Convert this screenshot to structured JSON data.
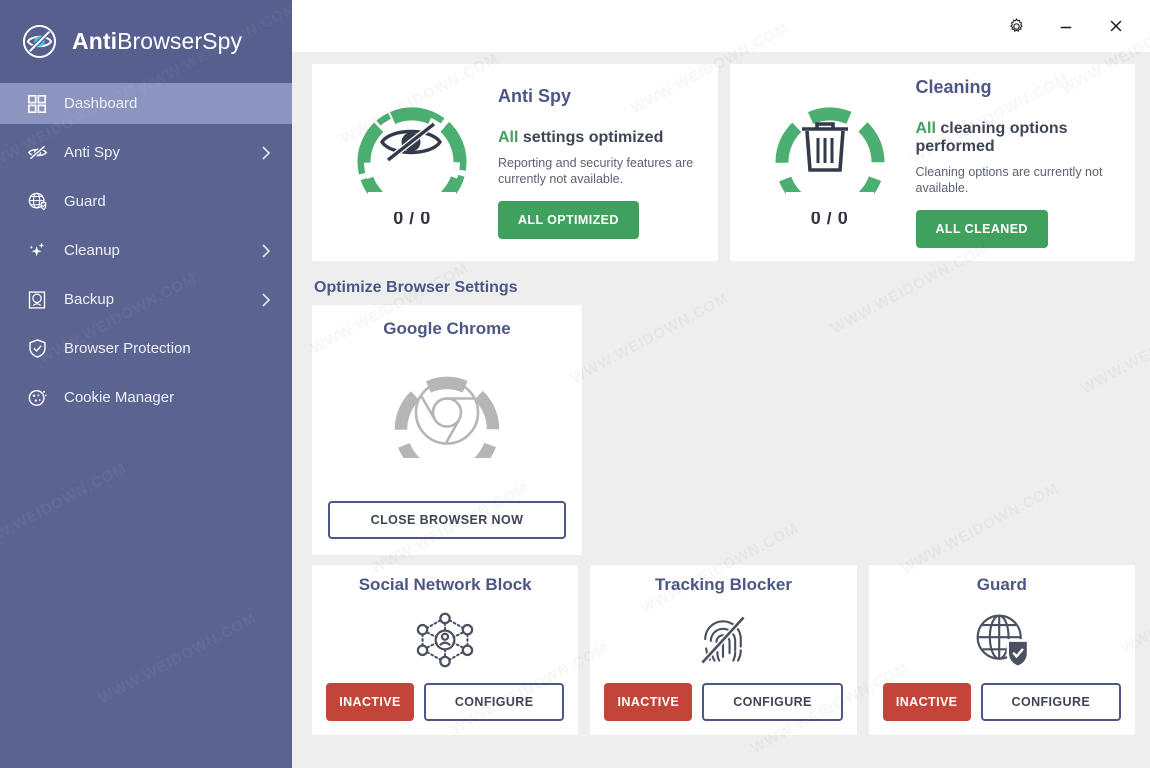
{
  "app": {
    "brand_bold": "Anti",
    "brand_light": "BrowserSpy",
    "logo_icon": "eye-slash-circle-icon",
    "watermark": "WWW.WEIDOWN.COM"
  },
  "titlebar": {
    "settings_icon": "gear-icon",
    "minimize_icon": "minimize-icon",
    "close_icon": "close-icon"
  },
  "sidebar": {
    "items": [
      {
        "label": "Dashboard",
        "icon": "grid-icon",
        "active": true,
        "chevron": false
      },
      {
        "label": "Anti Spy",
        "icon": "eye-slash-icon",
        "active": false,
        "chevron": true
      },
      {
        "label": "Guard",
        "icon": "globe-shield-icon",
        "active": false,
        "chevron": false
      },
      {
        "label": "Cleanup",
        "icon": "sparkles-icon",
        "active": false,
        "chevron": true
      },
      {
        "label": "Backup",
        "icon": "drive-icon",
        "active": false,
        "chevron": true
      },
      {
        "label": "Browser Protection",
        "icon": "shield-check-icon",
        "active": false,
        "chevron": false
      },
      {
        "label": "Cookie Manager",
        "icon": "cookie-icon",
        "active": false,
        "chevron": false
      }
    ]
  },
  "status_cards": [
    {
      "title": "Anti Spy",
      "gauge_icon": "eye-slash-icon",
      "gauge_count": "0 / 0",
      "gauge_color": "#4caf72",
      "headline_highlight": "All",
      "headline_rest": " settings optimized",
      "subtext": "Reporting and security features are currently not available.",
      "button_label": "ALL OPTIMIZED"
    },
    {
      "title": "Cleaning",
      "gauge_icon": "trash-icon",
      "gauge_count": "0 / 0",
      "gauge_color": "#4caf72",
      "headline_highlight": "All",
      "headline_rest": " cleaning options performed",
      "subtext": "Cleaning options are currently not available.",
      "button_label": "ALL CLEANED"
    }
  ],
  "section": {
    "optimize_title": "Optimize Browser Settings"
  },
  "browsers": [
    {
      "title": "Google Chrome",
      "gauge_icon": "chrome-icon",
      "gauge_color": "#b3b3b3",
      "button_label": "CLOSE BROWSER NOW"
    }
  ],
  "features": [
    {
      "title": "Social Network Block",
      "icon": "social-network-icon",
      "status_label": "INACTIVE",
      "status_color": "#c34539",
      "configure_label": "CONFIGURE"
    },
    {
      "title": "Tracking Blocker",
      "icon": "fingerprint-slash-icon",
      "status_label": "INACTIVE",
      "status_color": "#c34539",
      "configure_label": "CONFIGURE"
    },
    {
      "title": "Guard",
      "icon": "globe-shield-icon",
      "status_label": "INACTIVE",
      "status_color": "#c34539",
      "configure_label": "CONFIGURE"
    }
  ],
  "colors": {
    "sidebar": "#5b6491",
    "sidebar_active": "#8b95c0",
    "accent_blue": "#4c5785",
    "green": "#40a05e",
    "red": "#c34539",
    "background": "#eeeeee"
  }
}
